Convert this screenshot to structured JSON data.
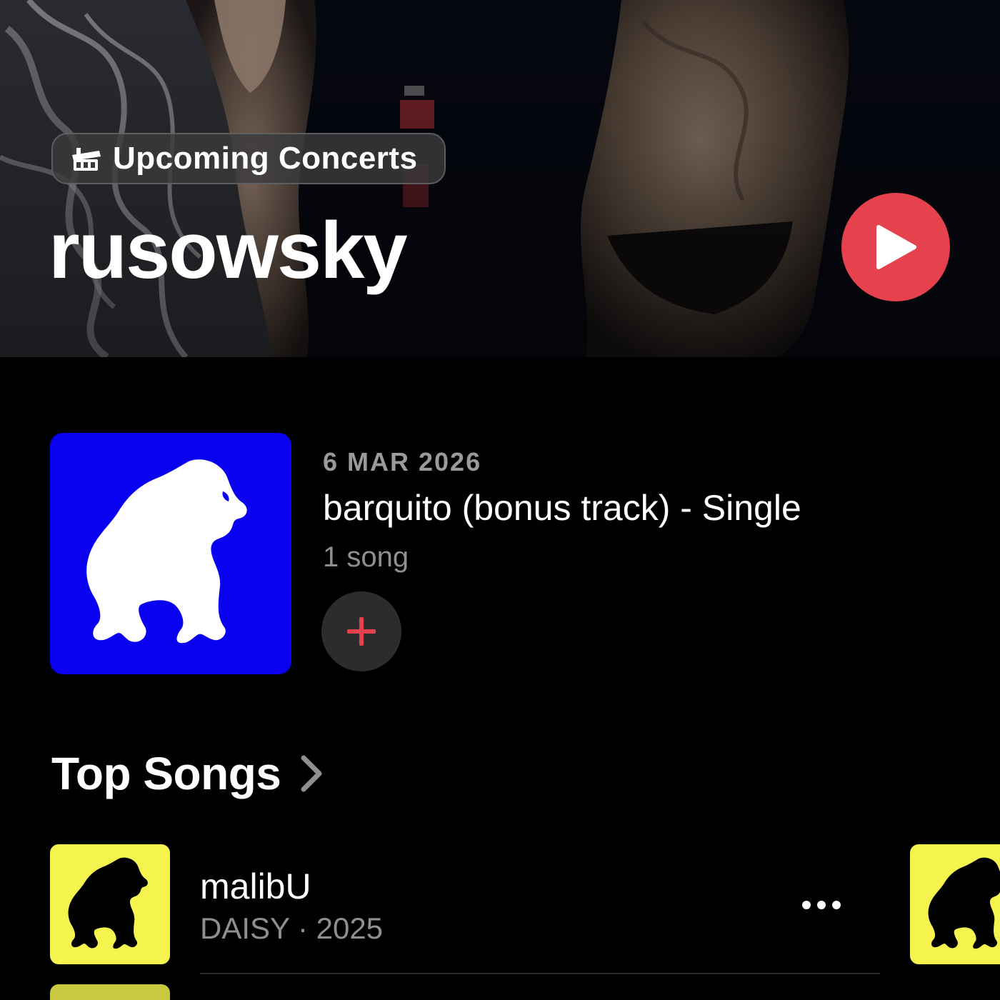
{
  "hero": {
    "concerts_label": "Upcoming Concerts",
    "artist_name": "rusowsky",
    "accent_color": "#e5424d"
  },
  "latest_release": {
    "date": "6 MAR 2026",
    "title": "barquito (bonus track) - Single",
    "song_count": "1 song",
    "artwork_color": "#0a00f0",
    "artwork_icon": "gorilla-icon"
  },
  "top_songs": {
    "header": "Top Songs",
    "items": [
      {
        "title": "malibU",
        "meta": "DAISY · 2025",
        "artwork_color": "#f5f34e",
        "artwork_icon": "gorilla-icon"
      }
    ]
  }
}
